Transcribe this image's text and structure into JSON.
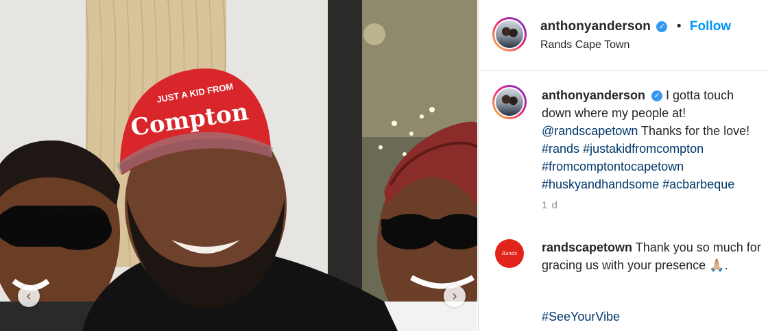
{
  "post": {
    "username": "anthonyanderson",
    "follow_label": "Follow",
    "location": "Rands Cape Town",
    "cap_username": "anthonyanderson",
    "cap_text_1": "I gotta touch down where my people at!",
    "cap_mention": "@randscapetown",
    "cap_text_2": "Thanks for the love!",
    "tag_1": "#rands",
    "tag_2": "#justakidfromcompton",
    "tag_3": "#fromcomptontocapetown",
    "tag_4": "#huskyandhandsome",
    "tag_5": "#acbarbeque",
    "time": "1 d"
  },
  "comment": {
    "username": "randscapetown",
    "avatar_text": "Rands",
    "text": "Thank you so much for gracing us with your presence",
    "emoji": "🙏🏼",
    "end": ".",
    "hashtag": "#SeeYourVibe"
  },
  "photo": {
    "hat_top_text": "JUST A KID FROM",
    "hat_main_text": "Compton"
  },
  "icons": {
    "prev": "chevron-left-icon",
    "next": "chevron-right-icon",
    "verified": "verified-badge-icon"
  },
  "colors": {
    "follow": "#0095f6",
    "verified": "#3897f0",
    "hat": "#d8262b",
    "rands": "#e1251b",
    "link": "#00376b"
  }
}
